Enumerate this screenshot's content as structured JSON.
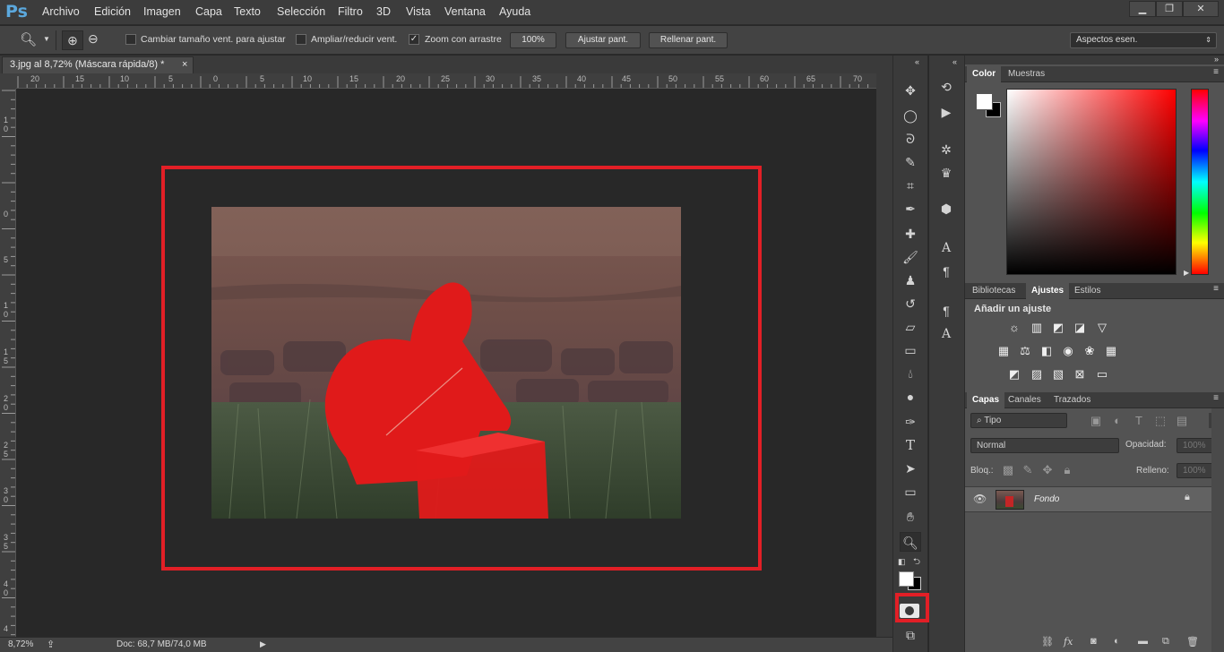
{
  "app": {
    "logo": "Ps"
  },
  "menu": [
    "Archivo",
    "Edición",
    "Imagen",
    "Capa",
    "Texto",
    "Selección",
    "Filtro",
    "3D",
    "Vista",
    "Ventana",
    "Ayuda"
  ],
  "window_controls": {
    "minimize": "▁",
    "restore": "❐",
    "close": "✕"
  },
  "options": {
    "resize_windows_label": "Cambiar tamaño vent. para ajustar",
    "zoom_all_label": "Ampliar/reducir vent.",
    "scrubby_zoom_label": "Zoom con arrastre",
    "scrubby_zoom_checked": "✓",
    "zoom_100": "100%",
    "fit_screen": "Ajustar pant.",
    "fill_screen": "Rellenar pant."
  },
  "workspace": {
    "value": "Aspectos esen."
  },
  "document": {
    "tab_title": "3.jpg al 8,72% (Máscara rápida/8) *",
    "tab_close": "×"
  },
  "rulers": {
    "top": [
      "20",
      "15",
      "10",
      "5",
      "0",
      "5",
      "10",
      "15",
      "20",
      "25",
      "30",
      "35",
      "40",
      "45",
      "50",
      "55",
      "60",
      "65",
      "70"
    ],
    "left": [
      "1",
      "0",
      "0",
      "5",
      "1",
      "0",
      "1",
      "5",
      "2",
      "0",
      "2",
      "5",
      "3",
      "0",
      "3",
      "5",
      "4",
      "0",
      "4"
    ]
  },
  "status": {
    "zoom": "8,72%",
    "doc": "Doc: 68,7 MB/74,0 MB"
  },
  "panels": {
    "color": {
      "tabs": [
        "Color",
        "Muestras"
      ]
    },
    "adjust": {
      "tabs": [
        "Bibliotecas",
        "Ajustes",
        "Estilos"
      ],
      "title": "Añadir un ajuste"
    },
    "layers": {
      "tabs": [
        "Capas",
        "Canales",
        "Trazados"
      ],
      "filter_kind": "Tipo",
      "blend_mode": "Normal",
      "opacity_label": "Opacidad:",
      "opacity_value": "100%",
      "lock_label": "Bloq.:",
      "fill_label": "Relleno:",
      "fill_value": "100%",
      "layer_name": "Fondo"
    }
  },
  "colors": {
    "mask_red": "#e21f26",
    "accent_blue": "#5ba8dd"
  }
}
